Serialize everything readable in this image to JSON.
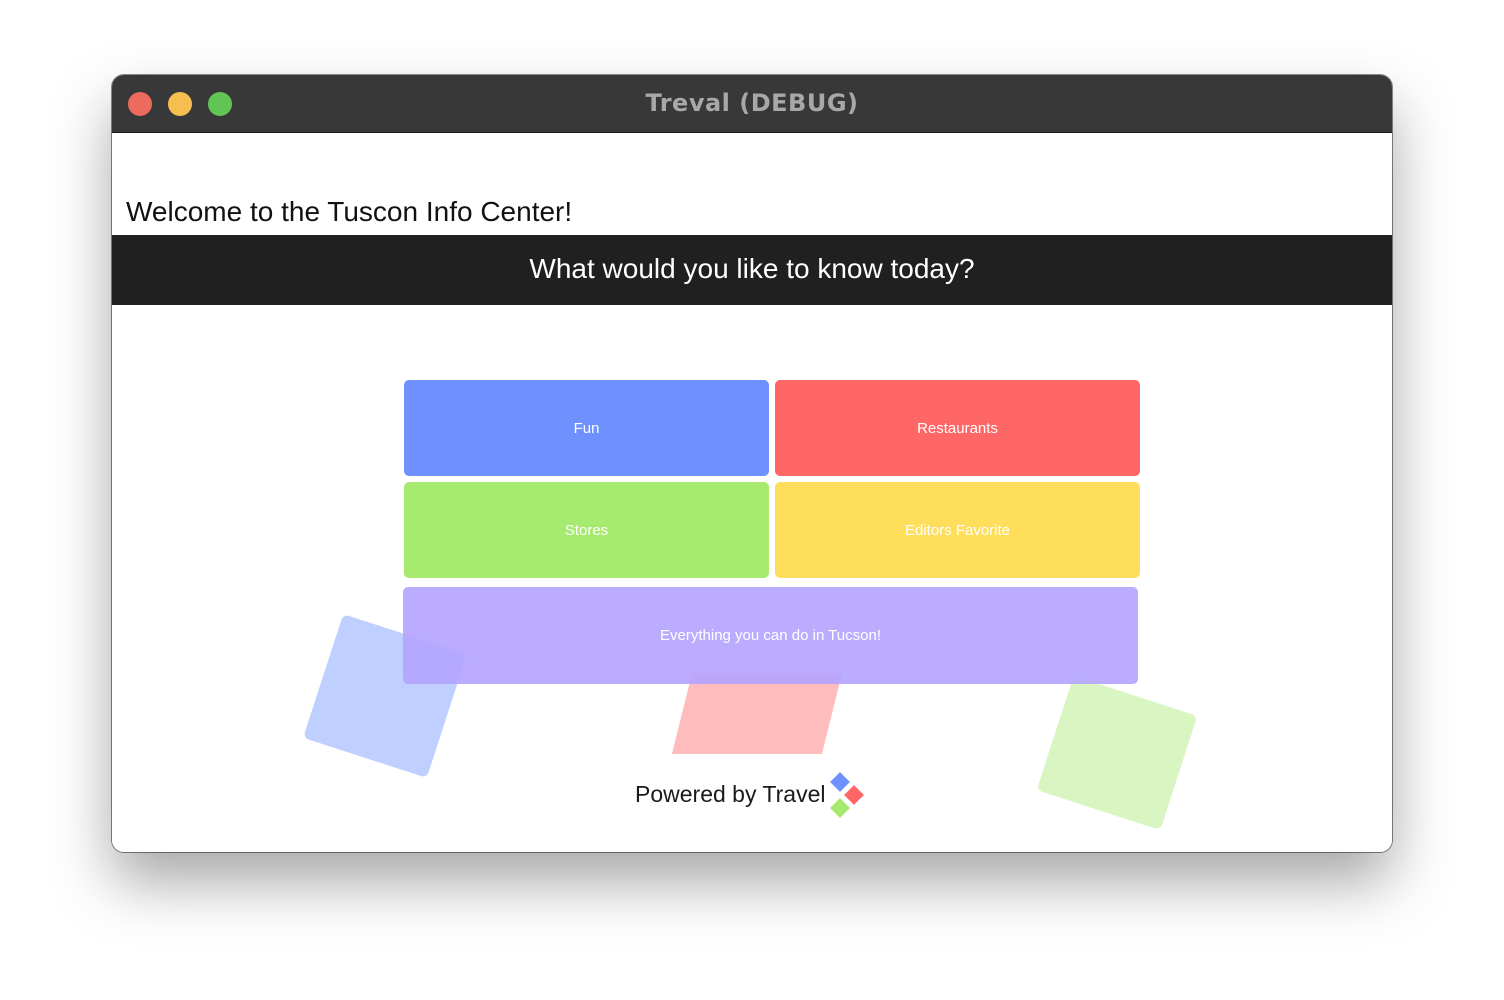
{
  "window": {
    "title": "Treval (DEBUG)"
  },
  "header": {
    "welcome": "Welcome to the Tuscon Info Center!",
    "banner": "What would you like to know today?"
  },
  "tiles": {
    "fun": "Fun",
    "restaurants": "Restaurants",
    "stores": "Stores",
    "editors_favorite": "Editors Favorite",
    "everything": "Everything you can do in Tucson!"
  },
  "footer": {
    "powered_by": "Powered by Travel",
    "logo_icon": "diamond-cluster-logo"
  },
  "colors": {
    "fun": "#6e91ff",
    "restaurants": "#ff6666",
    "stores": "#a7ea70",
    "editors_favorite": "#ffde5c",
    "everything": "#b4a3ff",
    "banner": "#202020"
  }
}
